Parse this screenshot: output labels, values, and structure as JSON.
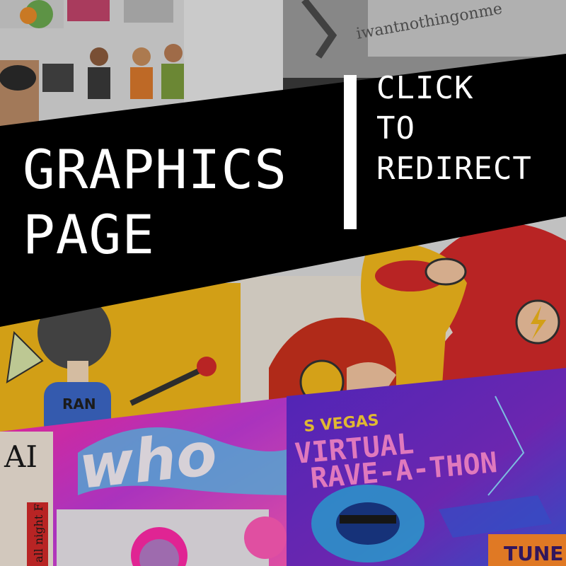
{
  "banner": {
    "headline_line1": "GRAPHICS",
    "headline_line2": "PAGE",
    "cta_line1": "CLICK",
    "cta_line2": "TO",
    "cta_line3": "REDIRECT"
  },
  "collage_text": {
    "handwritten_top": "iwantnothingonme",
    "shirt_label": "RAN",
    "magazine_letters": "AI",
    "magazine_side": "all night F",
    "who_lettering": "who",
    "rave_kicker": "S VEGAS",
    "rave_title_line1": "VIRTUAL",
    "rave_title_line2": "RAVE-A-THON",
    "tune_label": "TUNE"
  },
  "colors": {
    "banner": "#000000",
    "text": "#ffffff",
    "flash_red": "#d22a2a",
    "kid_flash_yellow": "#f2b81c",
    "rave_purple": "#6a2cc4",
    "magenta": "#e0209a"
  }
}
